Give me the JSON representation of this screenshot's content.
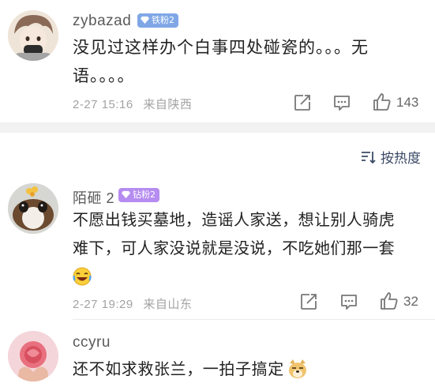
{
  "comments": [
    {
      "username": "zybazad",
      "badge": "铁粉2",
      "badge_color": "#7fa7e6",
      "lines": [
        "没见过这样办个白事四处碰瓷的。。。无",
        "语。。。。"
      ],
      "time": "2-27 15:16",
      "location": "来自陕西",
      "likes": "143"
    },
    {
      "username": "陌砸 2",
      "badge": "钻粉2",
      "badge_color": "#b58cf0",
      "lines": [
        "不愿出钱买墓地，造谣人家送，想让别人骑虎",
        "难下，可人家没说就是没说，不吃她们那一套"
      ],
      "emoji_1": "laughing-crying-emoji",
      "time": "2-27 19:29",
      "location": "来自山东",
      "likes": "32"
    },
    {
      "username": "ccyru",
      "lines": [
        "还不如求救张兰，一拍子搞定"
      ],
      "emoji_2": "doge-emoji"
    }
  ],
  "sort": {
    "label": "按热度",
    "icon": "sort-icon"
  },
  "icons": {
    "share": "share-icon",
    "reply": "comment-icon",
    "like": "thumbs-up-icon"
  }
}
